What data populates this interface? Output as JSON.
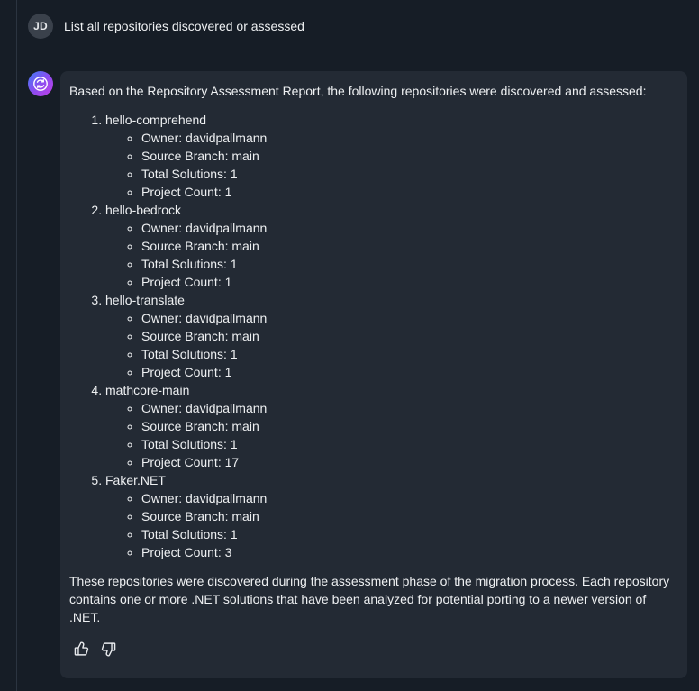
{
  "user": {
    "initials": "JD",
    "message": "List all repositories discovered or assessed"
  },
  "assistant": {
    "intro": "Based on the Repository Assessment Report, the following repositories were discovered and assessed:",
    "repositories": [
      {
        "name": "hello-comprehend",
        "details": [
          "Owner: davidpallmann",
          "Source Branch: main",
          "Total Solutions: 1",
          "Project Count: 1"
        ]
      },
      {
        "name": "hello-bedrock",
        "details": [
          "Owner: davidpallmann",
          "Source Branch: main",
          "Total Solutions: 1",
          "Project Count: 1"
        ]
      },
      {
        "name": "hello-translate",
        "details": [
          "Owner: davidpallmann",
          "Source Branch: main",
          "Total Solutions: 1",
          "Project Count: 1"
        ]
      },
      {
        "name": "mathcore-main",
        "details": [
          "Owner: davidpallmann",
          "Source Branch: main",
          "Total Solutions: 1",
          "Project Count: 17"
        ]
      },
      {
        "name": "Faker.NET",
        "details": [
          "Owner: davidpallmann",
          "Source Branch: main",
          "Total Solutions: 1",
          "Project Count: 3"
        ]
      }
    ],
    "outro": "These repositories were discovered during the assessment phase of the migration process. Each repository contains one or more .NET solutions that have been analyzed for potential porting to a newer version of .NET."
  },
  "feedback": {
    "icons": [
      "thumbs-up-icon",
      "thumbs-down-icon"
    ]
  },
  "colors": {
    "background": "#161d26",
    "bubble": "#232a34",
    "text": "#eef0f2",
    "avatar_gradient_start": "#3d7cf5",
    "avatar_gradient_end": "#c53ee8"
  }
}
